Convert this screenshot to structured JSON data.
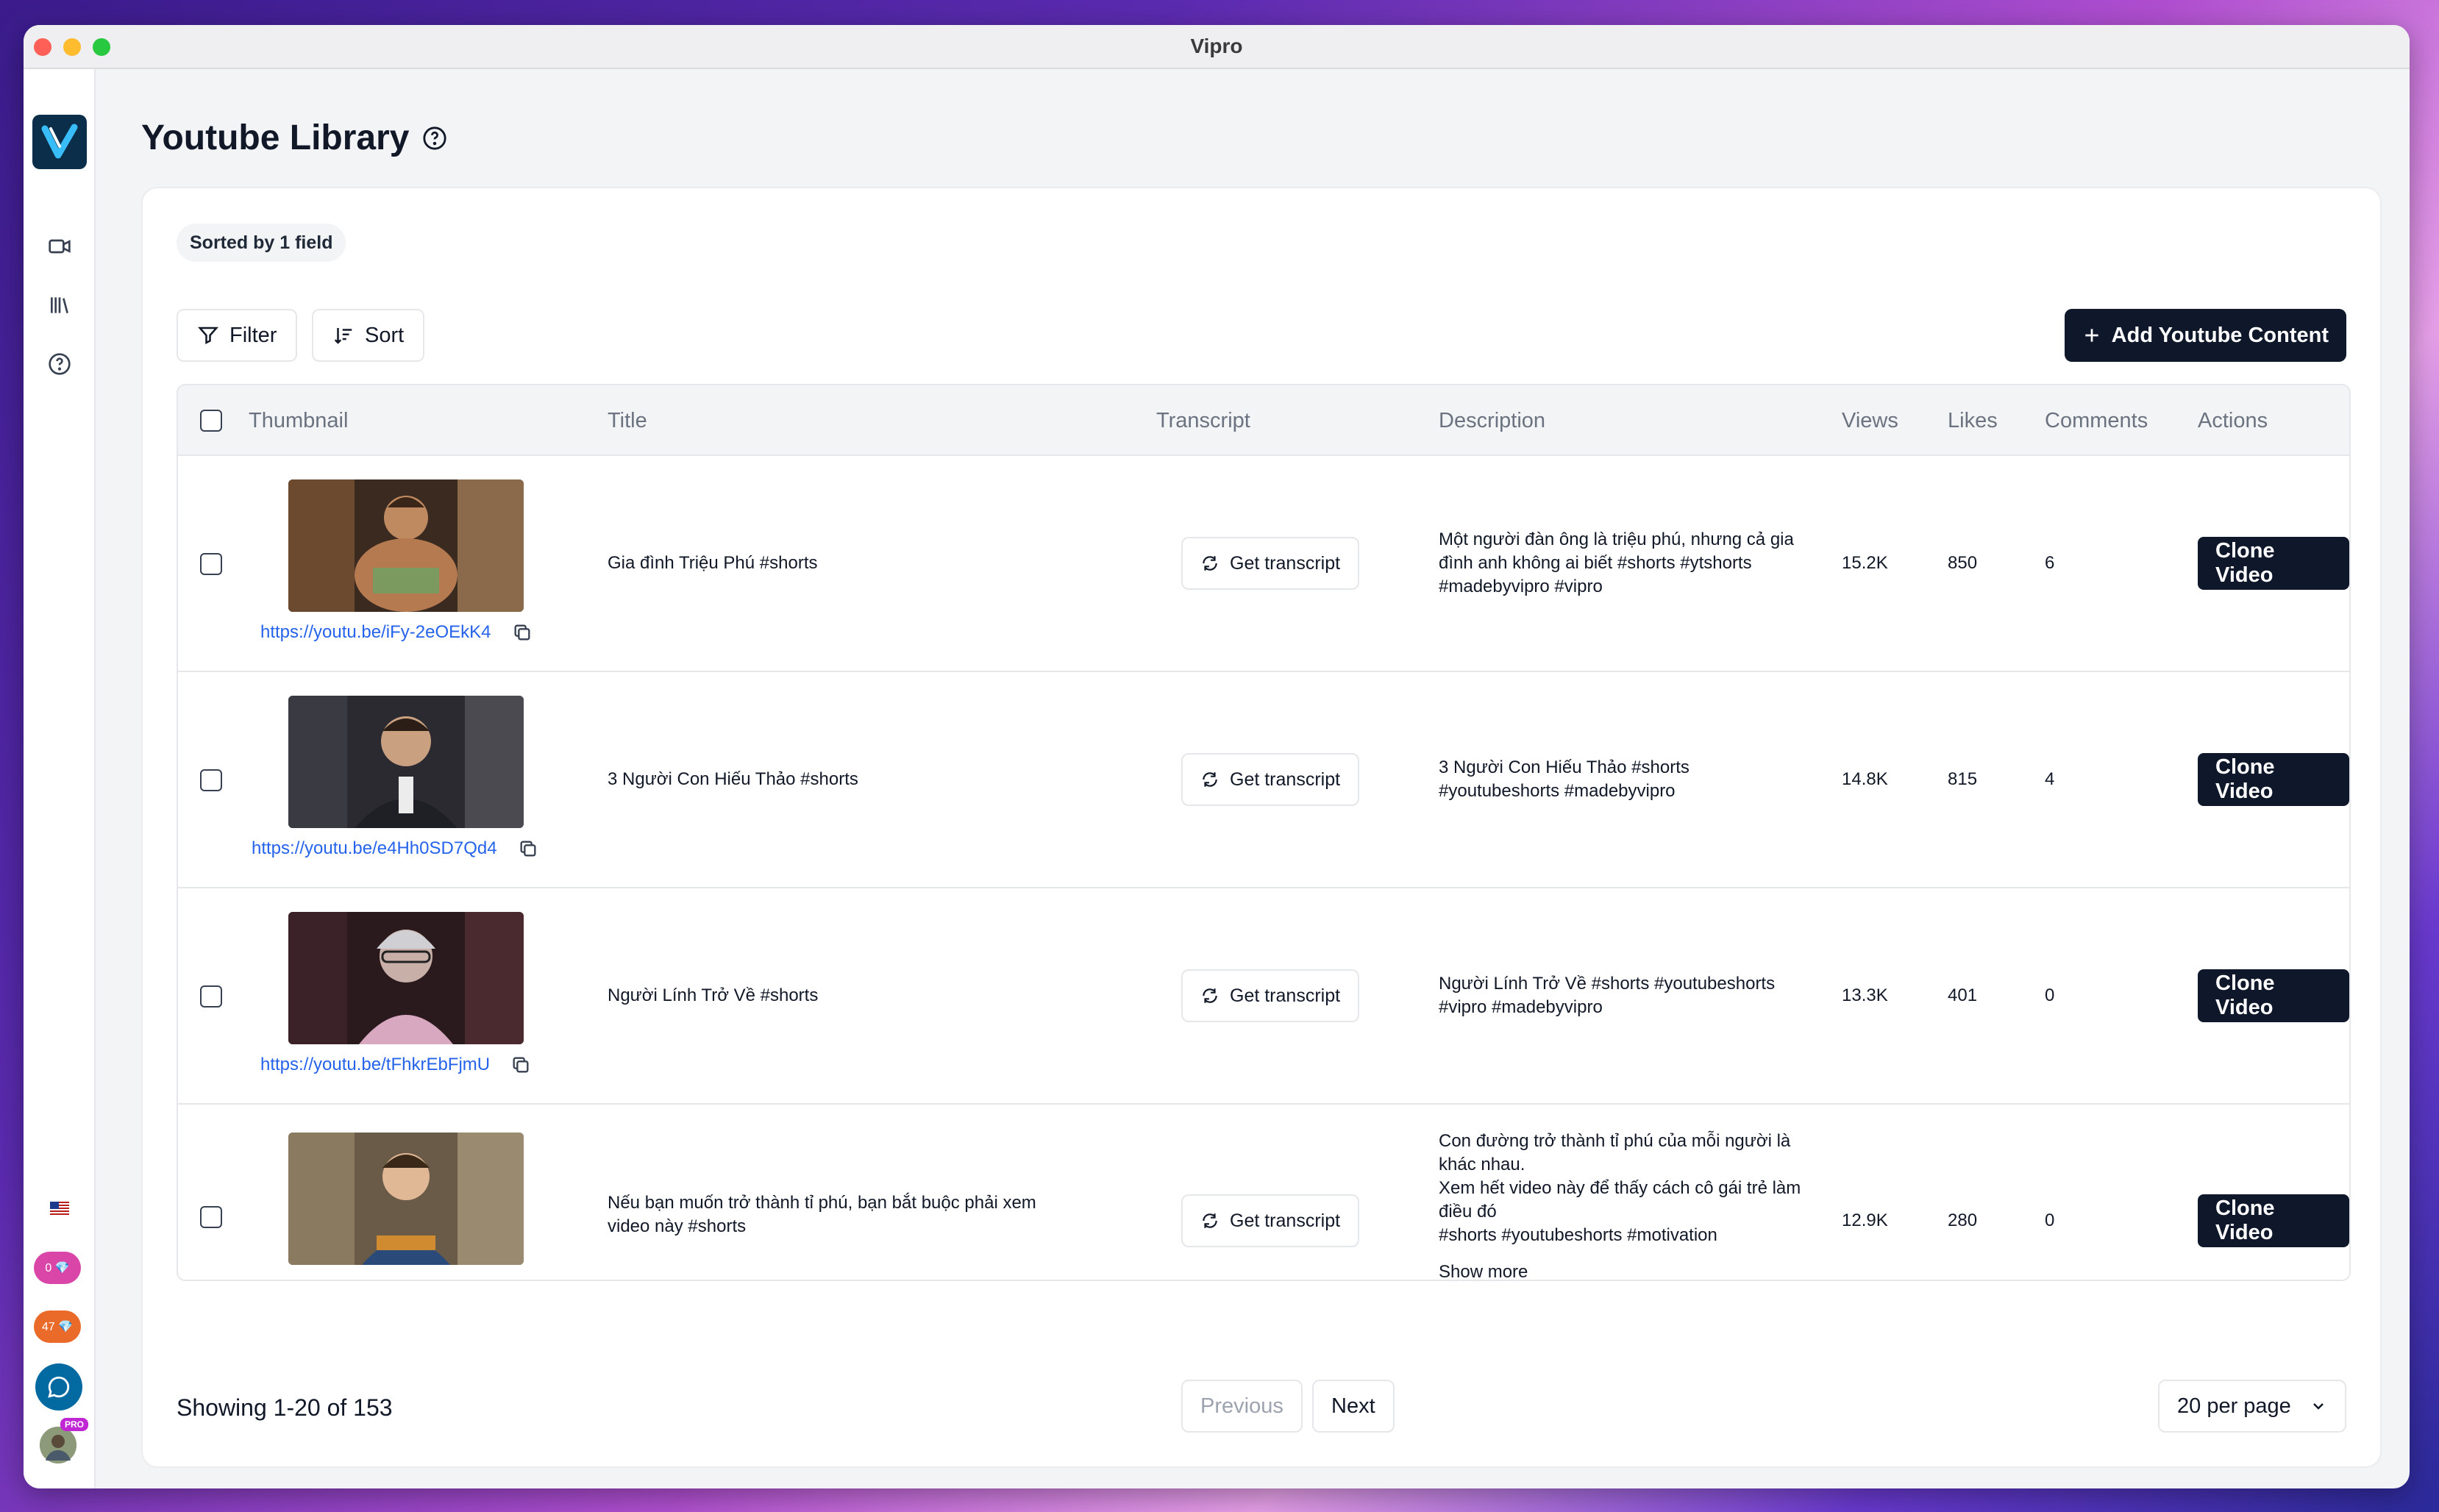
{
  "window": {
    "title": "Vipro"
  },
  "page": {
    "title": "Youtube Library"
  },
  "sidebar": {
    "badges": [
      {
        "label": "0 💎",
        "color": "#d946a8"
      },
      {
        "label": "47 💎",
        "color": "#ea6a2a"
      }
    ],
    "pro_label": "PRO"
  },
  "toolbar": {
    "sorted_label": "Sorted by 1 field",
    "filter_label": "Filter",
    "sort_label": "Sort",
    "add_label": "Add Youtube Content"
  },
  "table": {
    "headers": {
      "thumbnail": "Thumbnail",
      "title": "Title",
      "transcript": "Transcript",
      "description": "Description",
      "views": "Views",
      "likes": "Likes",
      "comments": "Comments",
      "actions": "Actions"
    },
    "transcript_label": "Get transcript",
    "clone_label": "Clone Video",
    "rows": [
      {
        "link": "https://youtu.be/iFy-2eOEkK4",
        "title": "Gia đình Triệu Phú #shorts",
        "description": "Một người đàn ông là triệu phú, nhưng cả gia đình anh không ai biết #shorts #ytshorts #madebyvipro #vipro",
        "views": "15.2K",
        "likes": "850",
        "comments": "6"
      },
      {
        "link": "https://youtu.be/e4Hh0SD7Qd4",
        "title": "3 Người Con Hiếu Thảo #shorts",
        "description": "3 Người Con Hiếu Thảo #shorts #youtubeshorts #madebyvipro",
        "views": "14.8K",
        "likes": "815",
        "comments": "4"
      },
      {
        "link": "https://youtu.be/tFhkrEbFjmU",
        "title": "Người Lính Trở Về #shorts",
        "description": "Người Lính Trở Về #shorts #youtubeshorts #vipro #madebyvipro",
        "views": "13.3K",
        "likes": "401",
        "comments": "0"
      },
      {
        "link": "",
        "title": "Nếu bạn muốn trở thành tỉ phú, bạn bắt buộc phải xem video này #shorts",
        "description": "Con đường trở thành tỉ phú của mỗi người là khác nhau.\nXem hết video này để thấy cách cô gái trẻ làm điều đó\n#shorts #youtubeshorts #motivation",
        "show_more": "Show more",
        "views": "12.9K",
        "likes": "280",
        "comments": "0"
      }
    ]
  },
  "pagination": {
    "showing": "Showing 1-20 of 153",
    "previous": "Previous",
    "next": "Next",
    "per_page": "20 per page"
  },
  "colors": {
    "primary": "#0f172a",
    "link": "#2563eb",
    "logo_bg": "#0b2f4a"
  }
}
